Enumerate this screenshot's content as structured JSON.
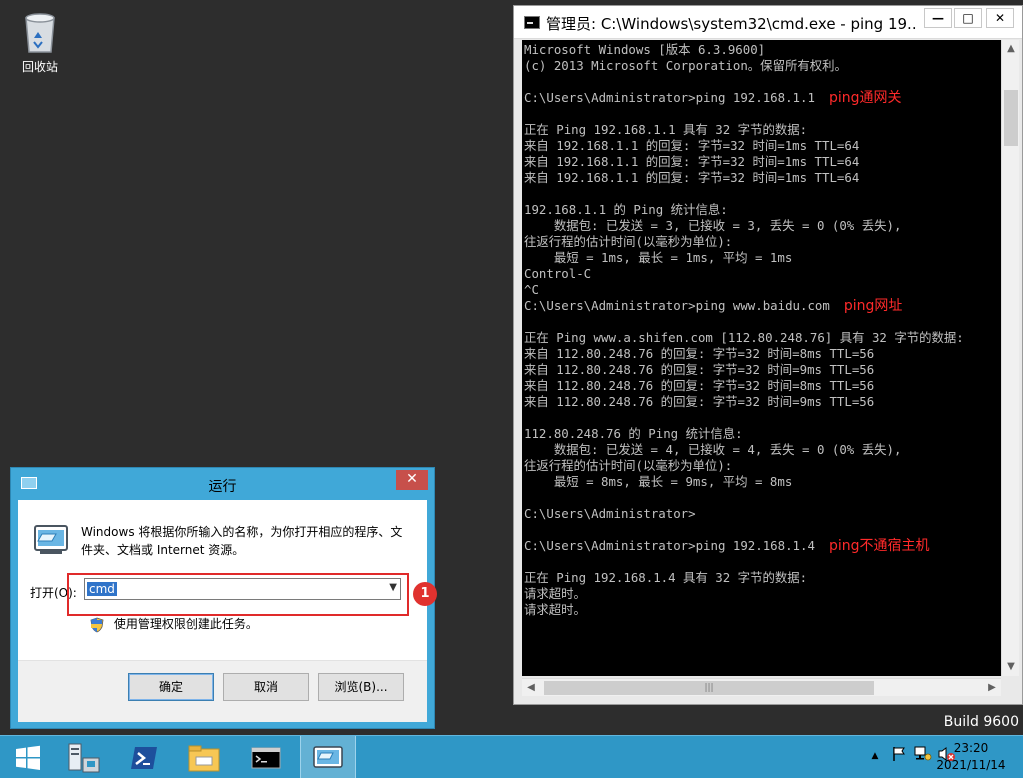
{
  "desktop": {
    "recycle_bin_label": "回收站",
    "build_label": "Build 9600"
  },
  "cmd_window": {
    "title": "管理员: C:\\Windows\\system32\\cmd.exe - ping  19...",
    "minimize_glyph": "—",
    "maximize_glyph": "□",
    "close_glyph": "✕",
    "lines": [
      "Microsoft Windows [版本 6.3.9600]",
      "(c) 2013 Microsoft Corporation。保留所有权利。",
      "",
      "C:\\Users\\Administrator>ping 192.168.1.1",
      "",
      "正在 Ping 192.168.1.1 具有 32 字节的数据:",
      "来自 192.168.1.1 的回复: 字节=32 时间=1ms TTL=64",
      "来自 192.168.1.1 的回复: 字节=32 时间=1ms TTL=64",
      "来自 192.168.1.1 的回复: 字节=32 时间=1ms TTL=64",
      "",
      "192.168.1.1 的 Ping 统计信息:",
      "    数据包: 已发送 = 3, 已接收 = 3, 丢失 = 0 (0% 丢失),",
      "往返行程的估计时间(以毫秒为单位):",
      "    最短 = 1ms, 最长 = 1ms, 平均 = 1ms",
      "Control-C",
      "^C",
      "C:\\Users\\Administrator>ping www.baidu.com",
      "",
      "正在 Ping www.a.shifen.com [112.80.248.76] 具有 32 字节的数据:",
      "来自 112.80.248.76 的回复: 字节=32 时间=8ms TTL=56",
      "来自 112.80.248.76 的回复: 字节=32 时间=9ms TTL=56",
      "来自 112.80.248.76 的回复: 字节=32 时间=8ms TTL=56",
      "来自 112.80.248.76 的回复: 字节=32 时间=9ms TTL=56",
      "",
      "112.80.248.76 的 Ping 统计信息:",
      "    数据包: 已发送 = 4, 已接收 = 4, 丢失 = 0 (0% 丢失),",
      "往返行程的估计时间(以毫秒为单位):",
      "    最短 = 8ms, 最长 = 9ms, 平均 = 8ms",
      "",
      "C:\\Users\\Administrator>",
      "",
      "C:\\Users\\Administrator>ping 192.168.1.4",
      "",
      "正在 Ping 192.168.1.4 具有 32 字节的数据:",
      "请求超时。",
      "请求超时。"
    ],
    "annotations": {
      "line_3": "ping通网关",
      "line_16": "ping网址",
      "line_31": "ping不通宿主机"
    },
    "text_color": "#c0c0c0",
    "annotation_color": "#ff2a2a"
  },
  "run_dialog": {
    "title": "运行",
    "close_glyph": "✕",
    "description": "Windows 将根据你所输入的名称，为你打开相应的程序、文件夹、文档或 Internet 资源。",
    "open_label": "打开(O):",
    "open_value": "cmd",
    "admin_note": "使用管理权限创建此任务。",
    "ok_label": "确定",
    "cancel_label": "取消",
    "browse_label": "浏览(B)...",
    "step_badge": "1",
    "title_color": "#40a8d8"
  },
  "taskbar": {
    "time": "23:20",
    "date": "2021/11/14",
    "tray_chevron": "▲",
    "color": "#2f97c6"
  }
}
